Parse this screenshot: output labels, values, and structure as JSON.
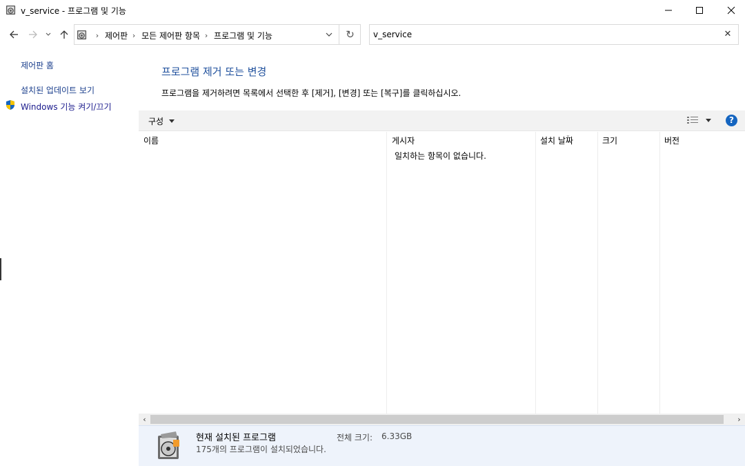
{
  "window": {
    "title": "v_service - 프로그램 및 기능",
    "icon": "programs-features-icon"
  },
  "nav": {
    "breadcrumbs": [
      "제어판",
      "모든 제어판 항목",
      "프로그램 및 기능"
    ],
    "search_value": "v_service",
    "icons": [
      "back-arrow-icon",
      "forward-arrow-icon",
      "recent-chevron-icon",
      "up-arrow-icon",
      "refresh-icon",
      "clear-icon"
    ]
  },
  "sidebar": {
    "links": [
      {
        "label": "제어판 홈"
      },
      {
        "label": "설치된 업데이트 보기"
      },
      {
        "label": "Windows 기능 켜기/끄기"
      }
    ]
  },
  "main": {
    "heading": "프로그램 제거 또는 변경",
    "instructions": "프로그램을 제거하려면 목록에서 선택한 후 [제거], [변경] 또는 [복구]를 클릭하십시오."
  },
  "toolbar": {
    "organize_label": "구성",
    "help_label": "?"
  },
  "table": {
    "columns": [
      "이름",
      "게시자",
      "설치 날짜",
      "크기",
      "버전"
    ],
    "empty_message": "일치하는 항목이 없습니다."
  },
  "details": {
    "title": "현재 설치된 프로그램",
    "total_size_label": "전체 크기:",
    "total_size_value": "6.33GB",
    "count_text": "175개의 프로그램이 설치되었습니다."
  },
  "colors": {
    "heading": "#1e4f9c",
    "link": "#1a3e8c",
    "help_bg": "#1565c0",
    "details_bg": "#eef3fb"
  }
}
